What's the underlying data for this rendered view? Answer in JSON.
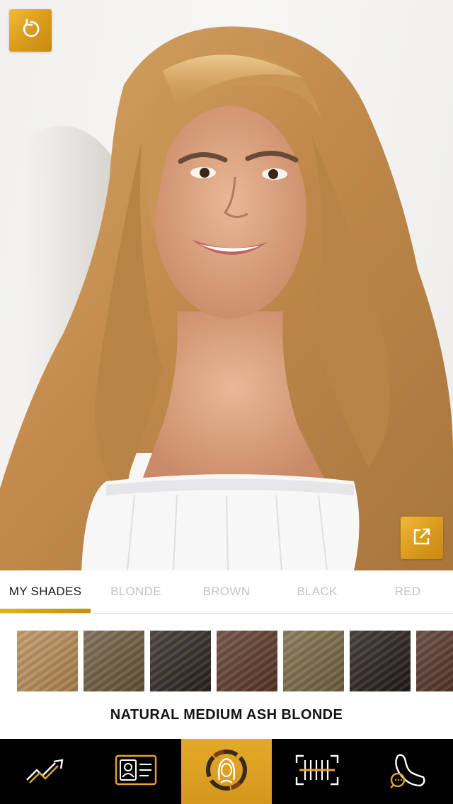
{
  "photo": {
    "description_icon": "model-photo",
    "reset_icon": "reset-icon",
    "share_icon": "share-icon"
  },
  "tabs": [
    {
      "label": "MY SHADES",
      "active": true
    },
    {
      "label": "BLONDE",
      "active": false
    },
    {
      "label": "BROWN",
      "active": false
    },
    {
      "label": "BLACK",
      "active": false
    },
    {
      "label": "RED",
      "active": false
    }
  ],
  "swatches": [
    {
      "color": "#b88a52",
      "selected": true
    },
    {
      "color": "#6a563a",
      "selected": false
    },
    {
      "color": "#2c221d",
      "selected": false
    },
    {
      "color": "#5b3526",
      "selected": false
    },
    {
      "color": "#75663f",
      "selected": false
    },
    {
      "color": "#221a17",
      "selected": false
    },
    {
      "color": "#4e2e22",
      "selected": false
    }
  ],
  "selected_shade": "NATURAL MEDIUM ASH BLONDE",
  "nav": [
    {
      "icon": "trend-chart-icon",
      "active": false
    },
    {
      "icon": "profile-card-icon",
      "active": false
    },
    {
      "icon": "hair-color-try-on-icon",
      "active": true
    },
    {
      "icon": "barcode-scan-icon",
      "active": false
    },
    {
      "icon": "chat-support-icon",
      "active": false
    }
  ],
  "colors": {
    "accent_gold": "#d89a1c",
    "tab_inactive": "#c3c3c3",
    "tab_active": "#1a1a1a",
    "nav_background": "#000000"
  }
}
